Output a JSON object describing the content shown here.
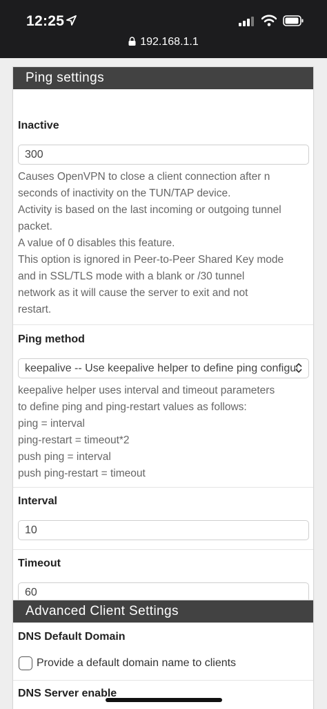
{
  "status": {
    "time": "12:25"
  },
  "browser": {
    "url": "192.168.1.1"
  },
  "ping_panel": {
    "heading": "Ping settings",
    "inactive": {
      "label": "Inactive",
      "value": "300",
      "help": [
        "Causes OpenVPN to close a client connection after n",
        "seconds of inactivity on the TUN/TAP device.",
        "Activity is based on the last incoming or outgoing tunnel",
        "packet.",
        "A value of 0 disables this feature.",
        "This option is ignored in Peer-to-Peer Shared Key mode",
        "and in SSL/TLS mode with a blank or /30 tunnel",
        "network as it will cause the server to exit and not",
        "restart."
      ]
    },
    "ping_method": {
      "label": "Ping method",
      "selected": "keepalive -- Use keepalive helper to define ping configuration",
      "help": [
        "keepalive helper uses interval and timeout parameters",
        "to define ping and ping-restart values as follows:",
        "ping = interval",
        "ping-restart = timeout*2",
        "push ping = interval",
        "push ping-restart = timeout"
      ]
    },
    "interval": {
      "label": "Interval",
      "value": "10"
    },
    "timeout": {
      "label": "Timeout",
      "value": "60"
    }
  },
  "advanced_panel": {
    "heading": "Advanced Client Settings",
    "dns_default_domain": {
      "label": "DNS Default Domain",
      "checkbox_label": "Provide a default domain name to clients",
      "checked": false
    },
    "dns_server_enable": {
      "label": "DNS Server enable"
    }
  }
}
